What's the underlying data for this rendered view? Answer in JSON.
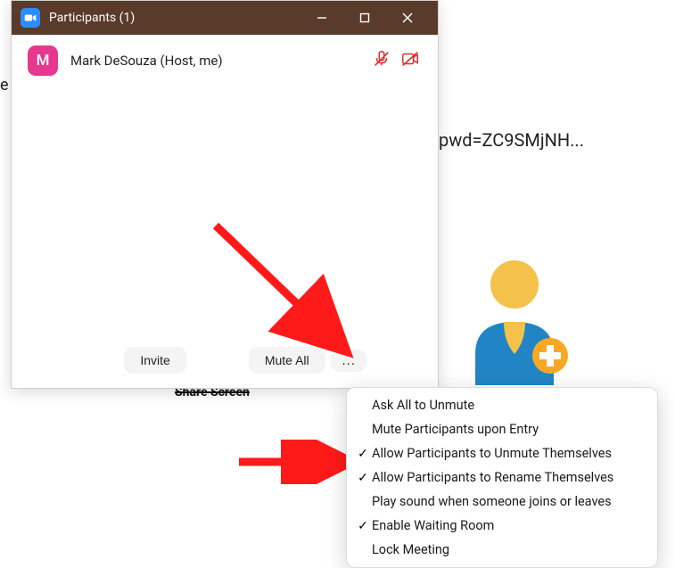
{
  "background": {
    "left_fragment": "e",
    "url_fragment": "pwd=ZC9SMjNH...",
    "share_screen": "Share Screen"
  },
  "window": {
    "title": "Participants (1)",
    "participant": {
      "initial": "M",
      "name": "Mark DeSouza (Host, me)"
    },
    "buttons": {
      "invite": "Invite",
      "mute_all": "Mute All",
      "more": "..."
    }
  },
  "menu": {
    "items": [
      {
        "checked": false,
        "label": "Ask All to Unmute"
      },
      {
        "checked": false,
        "label": "Mute Participants upon Entry"
      },
      {
        "checked": true,
        "label": "Allow Participants to Unmute Themselves"
      },
      {
        "checked": true,
        "label": "Allow Participants to Rename Themselves"
      },
      {
        "checked": false,
        "label": "Play sound when someone joins or leaves"
      },
      {
        "checked": true,
        "label": "Enable Waiting Room"
      },
      {
        "checked": false,
        "label": "Lock Meeting"
      }
    ]
  }
}
